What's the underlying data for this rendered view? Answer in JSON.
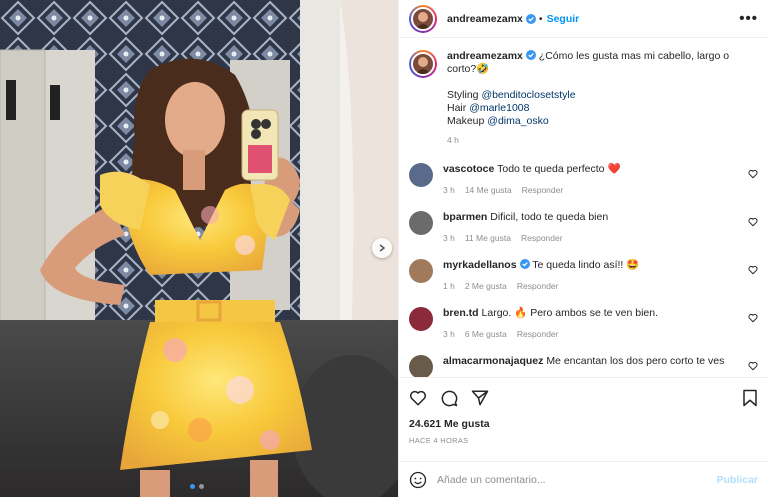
{
  "post": {
    "username": "andreamezamx",
    "follow_label": "Seguir",
    "more_label": "•••",
    "caption": {
      "text": "¿Cómo les gusta mas mi cabello, largo o corto?🤣",
      "styling_label": "Styling",
      "styling_mention": "@benditoclosetstyle",
      "hair_label": "Hair",
      "hair_mention": "@marle1008",
      "makeup_label": "Makeup",
      "makeup_mention": "@dima_osko",
      "age": "4 h"
    },
    "comments": [
      {
        "user": "vascotoce",
        "text": "Todo te queda perfecto ❤️",
        "age": "3 h",
        "likes": "14 Me gusta",
        "reply": "Responder",
        "avatar_color": "#5a6a8a",
        "verified": false
      },
      {
        "user": "bparmen",
        "text": "Dificil, todo te queda bien",
        "age": "3 h",
        "likes": "11 Me gusta",
        "reply": "Responder",
        "avatar_color": "#6b6b6b",
        "verified": false
      },
      {
        "user": "myrkadellanos",
        "text": "Te queda lindo así!! 🤩",
        "age": "1 h",
        "likes": "2 Me gusta",
        "reply": "Responder",
        "avatar_color": "#a07a5a",
        "verified": true
      },
      {
        "user": "bren.td",
        "text": "Largo. 🔥 Pero ambos se te ven bien.",
        "age": "3 h",
        "likes": "6 Me gusta",
        "reply": "Responder",
        "avatar_color": "#8a2a3a",
        "verified": false
      },
      {
        "user": "almacarmonajaquez",
        "text": "Me encantan los dos pero corto te ves",
        "age": "",
        "likes": "",
        "reply": "",
        "avatar_color": "#6a5a4a",
        "verified": false
      }
    ],
    "likes_count": "24.621 Me gusta",
    "posted_ago": "HACE 4 HORAS",
    "comment_placeholder": "Añade un comentario...",
    "publish_label": "Publicar"
  },
  "colors": {
    "accent": "#0095f6",
    "verified": "#3897f0",
    "heart_red": "#ed4956"
  }
}
